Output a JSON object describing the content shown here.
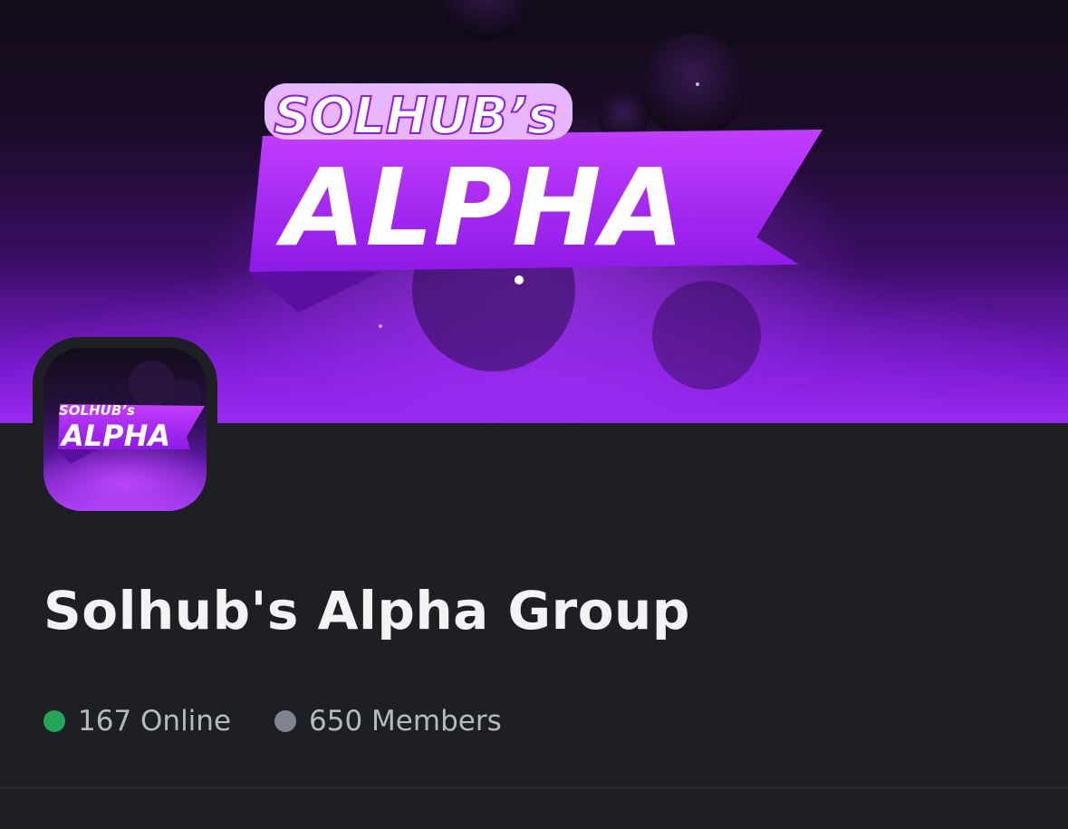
{
  "banner": {
    "line1": "SOLHUB’s",
    "line2": "ALPHA"
  },
  "avatar": {
    "line1": "SOLHUB’s",
    "line2": "ALPHA"
  },
  "server": {
    "name": "Solhub's Alpha Group",
    "online_label": "167 Online",
    "members_label": "650 Members"
  },
  "colors": {
    "accent_purple": "#a63cf5",
    "online_dot": "#23a55a",
    "members_dot": "#80848e",
    "background": "#1e1f22"
  }
}
